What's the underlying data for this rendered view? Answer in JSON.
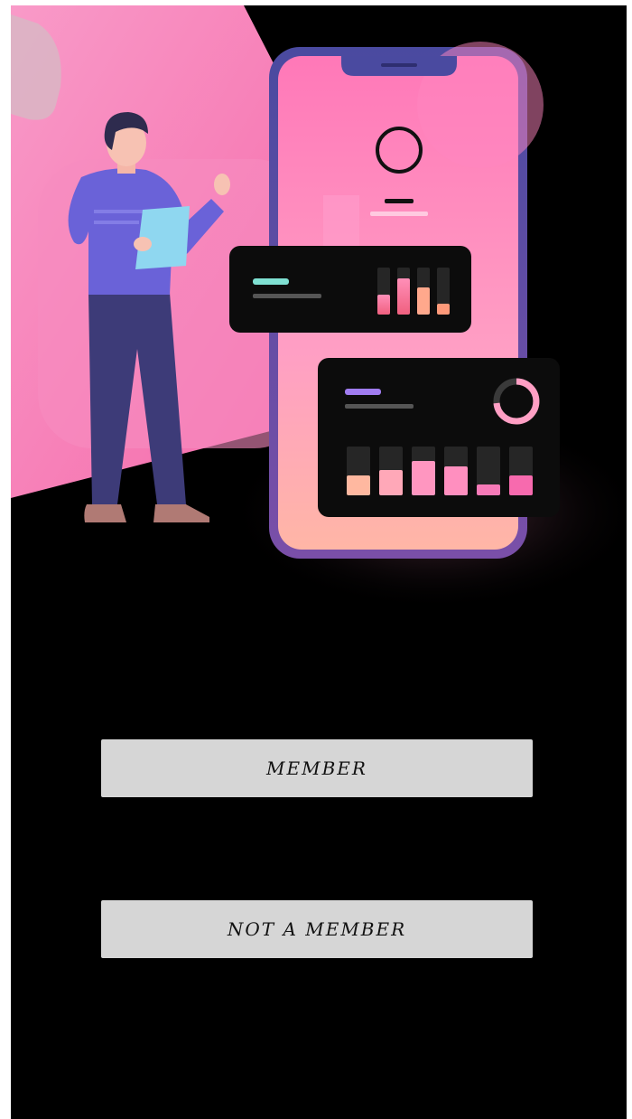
{
  "colors": {
    "background": "#000000",
    "pink_panel": "#f777b4",
    "phone_frame": "#5a4fa3",
    "phone_screen": "#ff8fbf",
    "card": "#0c0c0c",
    "button_bg": "#d6d6d6",
    "button_text": "#111111"
  },
  "illustration": {
    "icon": "person-with-phone-dashboard-illustration"
  },
  "buttons": {
    "member_label": "MEMBER",
    "not_member_label": "NOT A MEMBER"
  }
}
